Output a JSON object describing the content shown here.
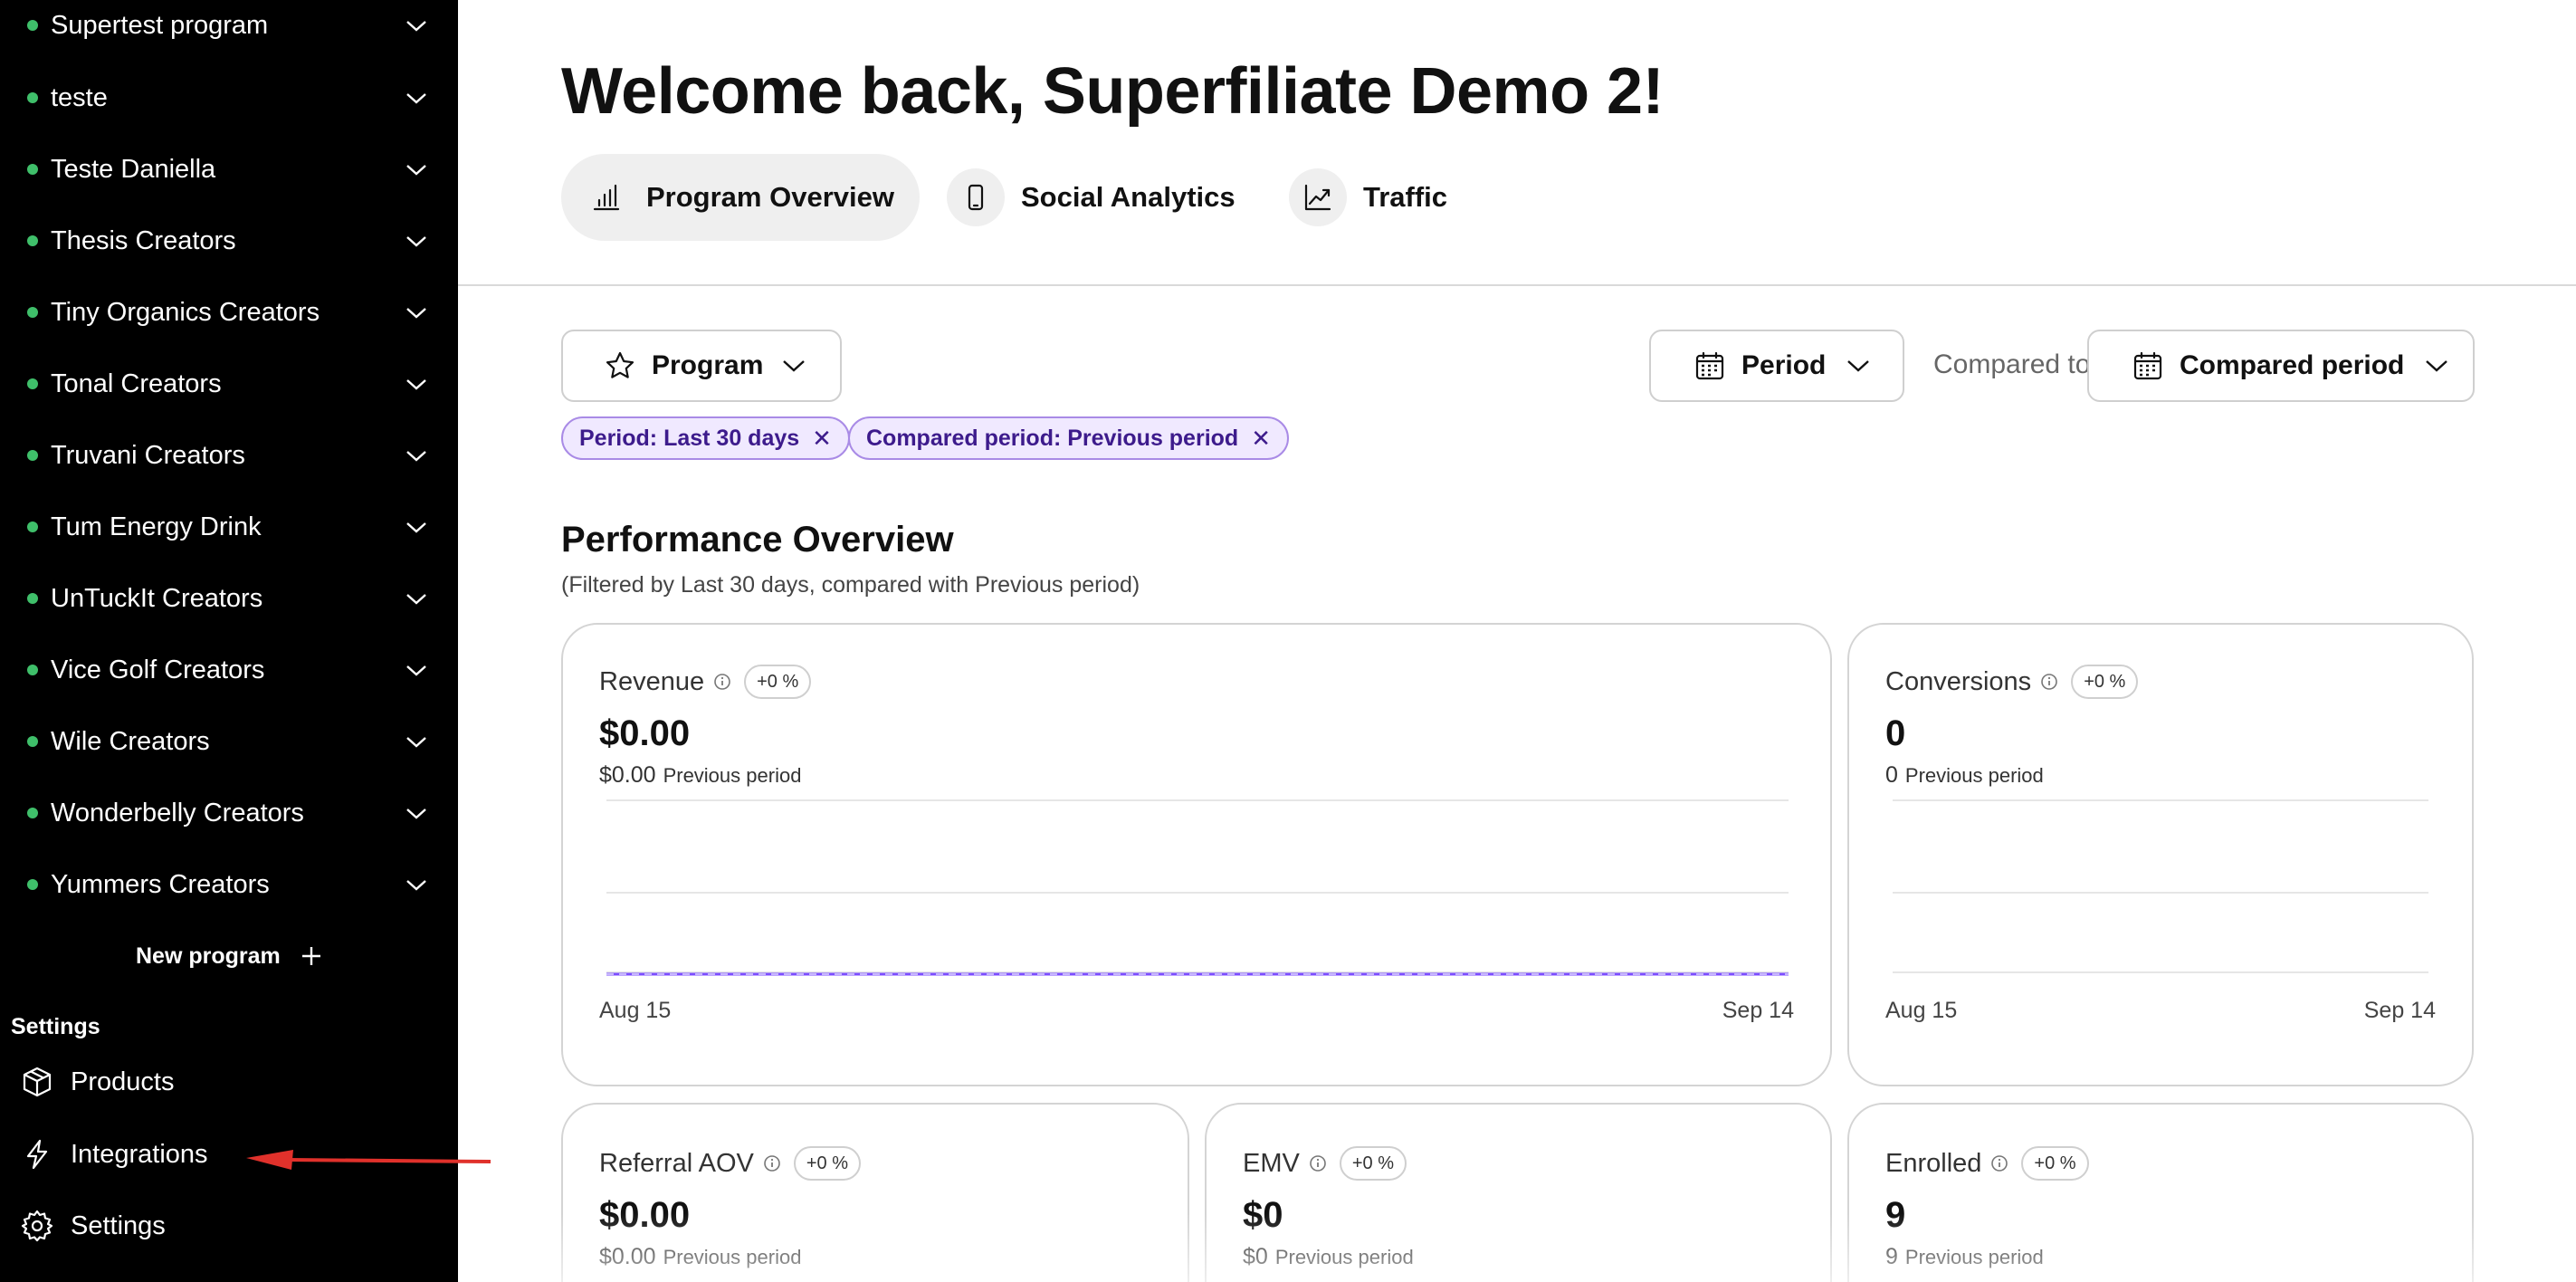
{
  "sidebar": {
    "programs": [
      {
        "label": "Supertest program"
      },
      {
        "label": "teste"
      },
      {
        "label": "Teste Daniella"
      },
      {
        "label": "Thesis Creators"
      },
      {
        "label": "Tiny Organics Creators"
      },
      {
        "label": "Tonal Creators"
      },
      {
        "label": "Truvani Creators"
      },
      {
        "label": "Tum Energy Drink"
      },
      {
        "label": "UnTuckIt Creators"
      },
      {
        "label": "Vice Golf Creators"
      },
      {
        "label": "Wile Creators"
      },
      {
        "label": "Wonderbelly Creators"
      },
      {
        "label": "Yummers Creators"
      }
    ],
    "new_program_label": "New program",
    "settings_heading": "Settings",
    "bottom_items": [
      {
        "label": "Products",
        "icon": "box-icon"
      },
      {
        "label": "Integrations",
        "icon": "lightning-icon"
      },
      {
        "label": "Settings",
        "icon": "gear-icon"
      }
    ],
    "status_dot_color": "#3fbf6a"
  },
  "annotation": {
    "arrow_color": "#e0312b"
  },
  "main": {
    "title": "Welcome back, Superfiliate Demo 2!",
    "tabs": [
      {
        "label": "Program Overview",
        "icon": "bar-chart-icon",
        "active": true
      },
      {
        "label": "Social Analytics",
        "icon": "phone-icon",
        "active": false
      },
      {
        "label": "Traffic",
        "icon": "trend-up-icon",
        "active": false
      }
    ],
    "filters": {
      "program_label": "Program",
      "period_label": "Period",
      "compared_to_label": "Compared to",
      "compared_period_label": "Compared period"
    },
    "chips": [
      {
        "label": "Period: Last 30 days"
      },
      {
        "label": "Compared period: Previous period"
      }
    ],
    "section_title": "Performance Overview",
    "section_subtitle": "(Filtered by Last 30 days, compared with Previous period)",
    "cards": [
      {
        "label": "Revenue",
        "badge": "+0 %",
        "value": "$0.00",
        "prev_value": "$0.00",
        "prev_label": "Previous period",
        "axis_start": "Aug 15",
        "axis_end": "Sep 14",
        "line_color": "#7c4dff"
      },
      {
        "label": "Conversions",
        "badge": "+0 %",
        "value": "0",
        "prev_value": "0",
        "prev_label": "Previous period",
        "axis_start": "Aug 15",
        "axis_end": "Sep 14"
      },
      {
        "label": "Referral AOV",
        "badge": "+0 %",
        "value": "$0.00",
        "prev_value": "$0.00",
        "prev_label": "Previous period"
      },
      {
        "label": "EMV",
        "badge": "+0 %",
        "value": "$0",
        "prev_value": "$0",
        "prev_label": "Previous period"
      },
      {
        "label": "Enrolled",
        "badge": "+0 %",
        "value": "9",
        "prev_value": "9",
        "prev_label": "Previous period"
      }
    ]
  }
}
